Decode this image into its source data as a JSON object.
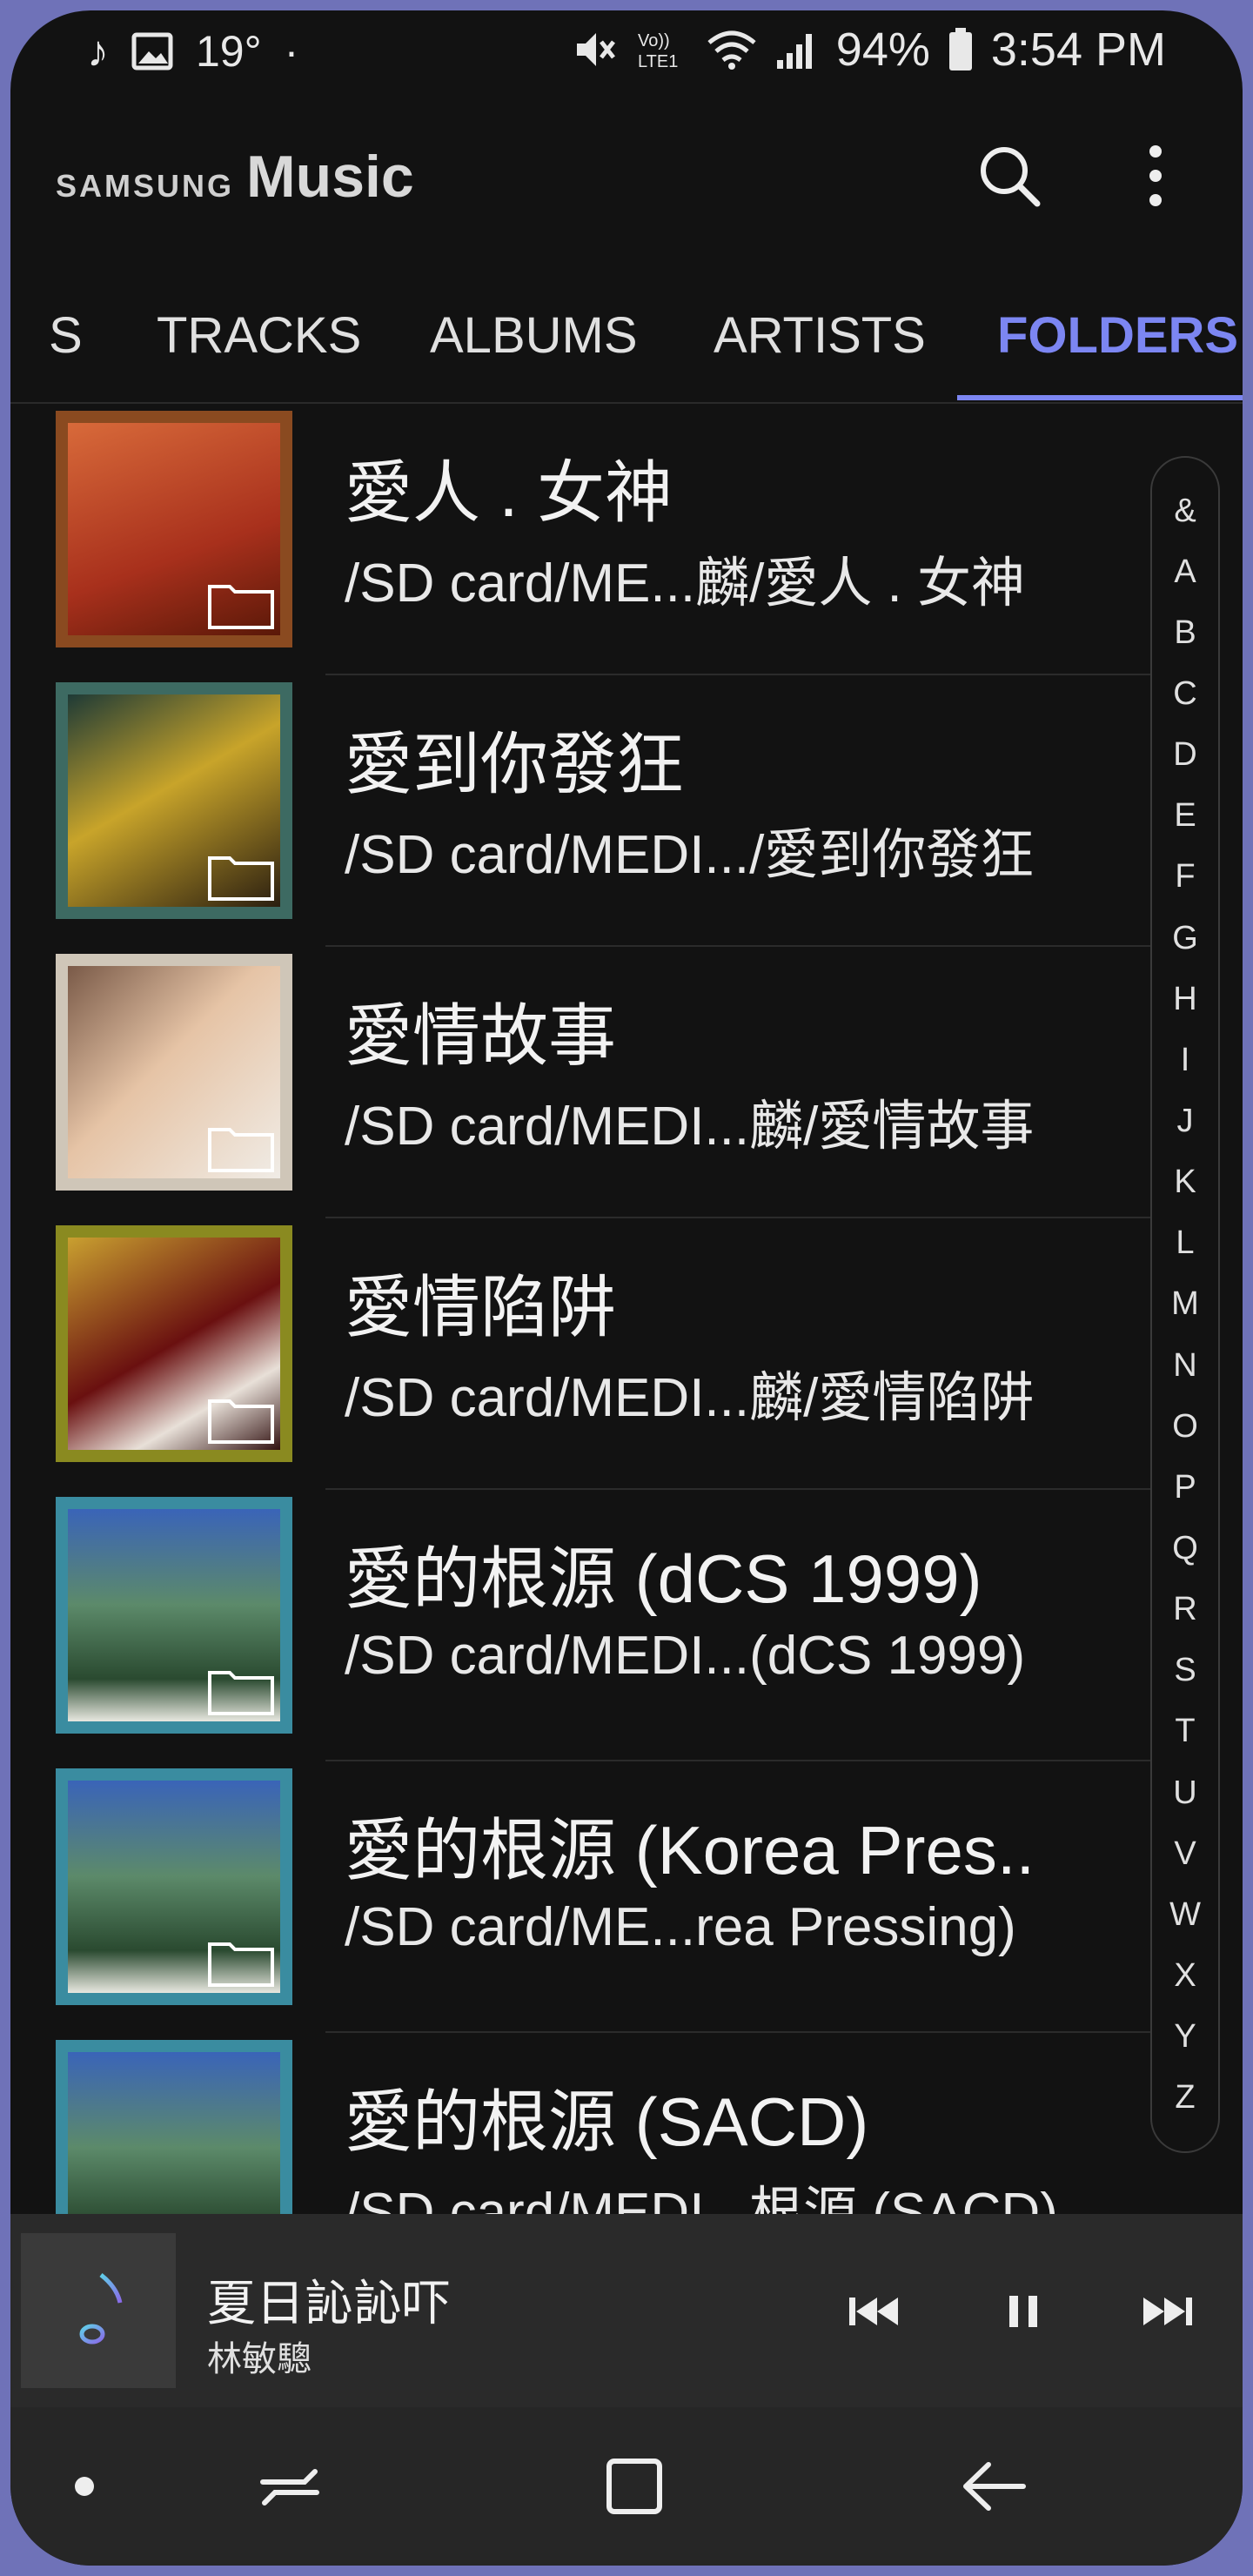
{
  "status_bar": {
    "temperature": "19°",
    "dot": "·",
    "battery": "94%",
    "time": "3:54 PM"
  },
  "header": {
    "brand": "SAMSUNG",
    "app_name": "Music"
  },
  "tabs": [
    {
      "label": "S",
      "active": false
    },
    {
      "label": "TRACKS",
      "active": false
    },
    {
      "label": "ALBUMS",
      "active": false
    },
    {
      "label": "ARTISTS",
      "active": false
    },
    {
      "label": "FOLDERS",
      "active": true
    }
  ],
  "folders": [
    {
      "title": "愛人 . 女神",
      "path": "/SD card/ME...麟/愛人 . 女神",
      "art": "brown-red"
    },
    {
      "title": "愛到你發狂",
      "path": "/SD card/MEDI.../愛到你發狂",
      "art": "teal-dark"
    },
    {
      "title": "愛情故事",
      "path": "/SD card/MEDI...麟/愛情故事",
      "art": "light"
    },
    {
      "title": "愛情陷阱",
      "path": "/SD card/MEDI...麟/愛情陷阱",
      "art": "gold"
    },
    {
      "title": "愛的根源 (dCS 1999)",
      "path": "/SD card/MEDI...(dCS 1999)",
      "art": "blue-green"
    },
    {
      "title": "愛的根源 (Korea Pres..",
      "path": "/SD card/ME...rea Pressing)",
      "art": "blue-green"
    },
    {
      "title": "愛的根源 (SACD)",
      "path": "/SD card/MEDI...根源 (SACD)",
      "art": "blue-green"
    }
  ],
  "index_letters": [
    "&",
    "A",
    "B",
    "C",
    "D",
    "E",
    "F",
    "G",
    "H",
    "I",
    "J",
    "K",
    "L",
    "M",
    "N",
    "O",
    "P",
    "Q",
    "R",
    "S",
    "T",
    "U",
    "V",
    "W",
    "X",
    "Y",
    "Z"
  ],
  "player": {
    "song": "夏日訫訫吓",
    "artist": "林敏驄"
  },
  "colors": {
    "accent": "#7c86f2",
    "background": "#121212",
    "player_bg": "#2a2a2a",
    "nav_bg": "#262626"
  }
}
